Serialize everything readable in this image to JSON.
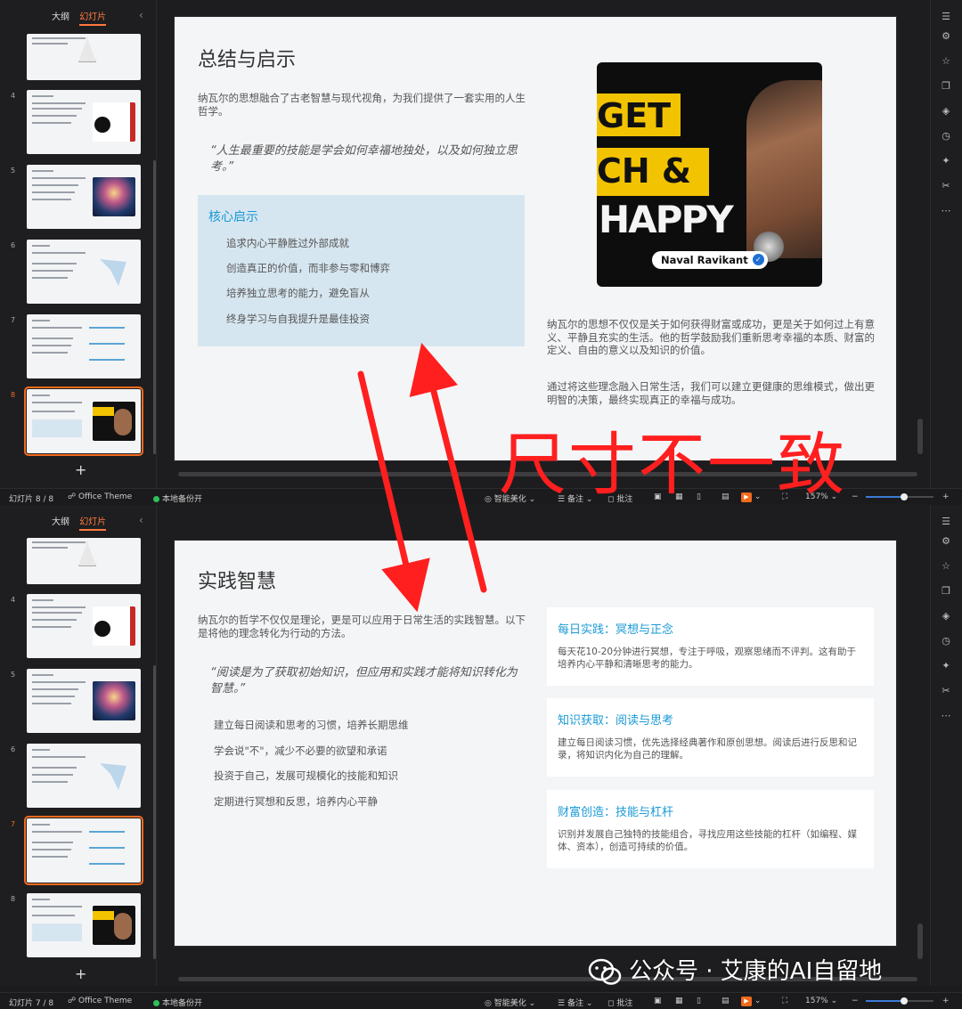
{
  "sidebar": {
    "tab_outline": "大纲",
    "tab_slides": "幻灯片",
    "collapse": "‹",
    "add": "+"
  },
  "top_pane": {
    "thumbs": [
      "4",
      "5",
      "6",
      "7",
      "8"
    ],
    "slide": {
      "title": "总结与启示",
      "intro": "纳瓦尔的思想融合了古老智慧与现代视角，为我们提供了一套实用的人生哲学。",
      "quote": "“人生最重要的技能是学会如何幸福地独处，以及如何独立思考。”",
      "core_title": "核心启示",
      "core_items": [
        "追求内心平静胜过外部成就",
        "创造真正的价值，而非参与零和博弈",
        "培养独立思考的能力，避免盲从",
        "终身学习与自我提升是最佳投资"
      ],
      "photo": {
        "line1": "GET",
        "line2": "CH &",
        "line3": "HAPPY",
        "name": "Naval Ravikant"
      },
      "right_para1": "纳瓦尔的思想不仅仅是关于如何获得财富或成功，更是关于如何过上有意义、平静且充实的生活。他的哲学鼓励我们重新思考幸福的本质、财富的定义、自由的意义以及知识的价值。",
      "right_para2": "通过将这些理念融入日常生活，我们可以建立更健康的思维模式，做出更明智的决策，最终实现真正的幸福与成功。"
    },
    "status": {
      "slide_counter": "幻灯片 8 / 8"
    }
  },
  "bottom_pane": {
    "thumbs": [
      "4",
      "5",
      "6",
      "7",
      "8"
    ],
    "slide": {
      "title": "实践智慧",
      "intro": "纳瓦尔的哲学不仅仅是理论，更是可以应用于日常生活的实践智慧。以下是将他的理念转化为行动的方法。",
      "quote": "“阅读是为了获取初始知识，但应用和实践才能将知识转化为智慧。”",
      "bullets": [
        "建立每日阅读和思考的习惯，培养长期思维",
        "学会说\"不\"，减少不必要的欲望和承诺",
        "投资于自己，发展可规模化的技能和知识",
        "定期进行冥想和反思，培养内心平静"
      ],
      "cards": [
        {
          "title": "每日实践：冥想与正念",
          "desc": "每天花10-20分钟进行冥想，专注于呼吸，观察思绪而不评判。这有助于培养内心平静和清晰思考的能力。"
        },
        {
          "title": "知识获取：阅读与思考",
          "desc": "建立每日阅读习惯，优先选择经典著作和原创思想。阅读后进行反思和记录，将知识内化为自己的理解。"
        },
        {
          "title": "财富创造：技能与杠杆",
          "desc": "识别并发展自己独特的技能组合，寻找应用这些技能的杠杆（如编程、媒体、资本），创造可持续的价值。"
        }
      ]
    },
    "status": {
      "slide_counter": "幻灯片 7 / 8"
    }
  },
  "status_common": {
    "theme": "Office Theme",
    "backup": "本地备份开",
    "beautify": "智能美化",
    "notes": "备注",
    "comments": "批注",
    "zoom": "157%",
    "zoom_minus": "−",
    "zoom_plus": "+",
    "zoom_level": 0.57
  },
  "annotation": {
    "text": "尺寸不一致",
    "color": "#ff1f1f"
  },
  "watermark": {
    "text": "公众号 · 艾康的AI自留地"
  },
  "colors": {
    "accent_orange": "#f26b1d",
    "title_blue": "#1a9ad6"
  }
}
